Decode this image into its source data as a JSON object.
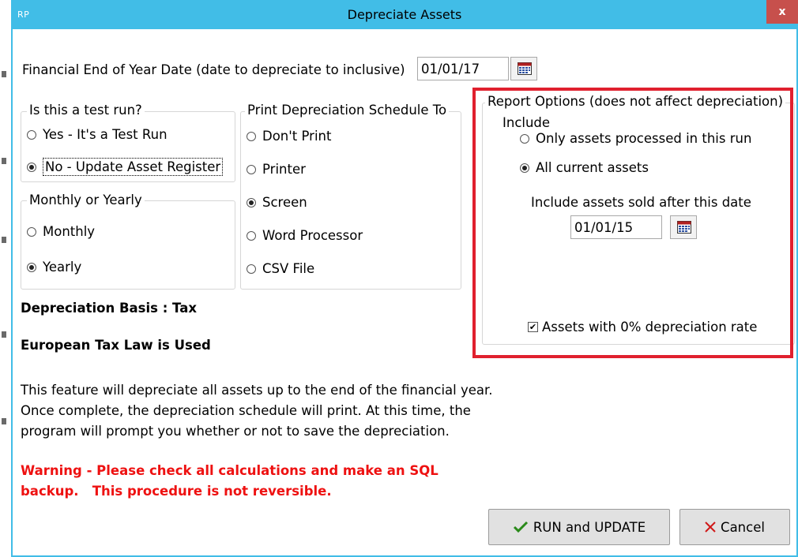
{
  "window": {
    "icon_text": "RP",
    "title": "Depreciate Assets",
    "close_label": "x"
  },
  "fy": {
    "label": "Financial End of Year Date (date to depreciate to inclusive)",
    "value": "01/01/17",
    "calendar_icon": "calendar-icon"
  },
  "test_run": {
    "legend": "Is this a test run?",
    "options": [
      {
        "label": "Yes - It's a Test Run",
        "selected": false
      },
      {
        "label": "No - Update Asset Register",
        "selected": true
      }
    ]
  },
  "period": {
    "legend": "Monthly or Yearly",
    "options": [
      {
        "label": "Monthly",
        "selected": false
      },
      {
        "label": "Yearly",
        "selected": true
      }
    ]
  },
  "print_to": {
    "legend": "Print Depreciation Schedule To",
    "options": [
      {
        "label": "Don't Print",
        "selected": false
      },
      {
        "label": "Printer",
        "selected": false
      },
      {
        "label": "Screen",
        "selected": true
      },
      {
        "label": "Word Processor",
        "selected": false
      },
      {
        "label": "CSV File",
        "selected": false
      }
    ]
  },
  "report": {
    "legend": "Report Options (does not affect depreciation)",
    "include_label": "Include",
    "options": [
      {
        "label": "Only assets processed in this run",
        "selected": false
      },
      {
        "label": "All current assets",
        "selected": true
      }
    ],
    "sold_after_label": "Include assets sold after this date",
    "sold_after_value": "01/01/15",
    "zero_rate_label": "Assets with 0% depreciation rate",
    "zero_rate_checked": true,
    "highlight_color": "#e0202e"
  },
  "info": {
    "basis": "Depreciation Basis : Tax",
    "law": "European Tax Law is Used",
    "paragraph": "This feature will depreciate all assets up to the end of the financial year. Once complete, the depreciation schedule will print. At this time, the program will prompt you whether or not to save the depreciation.",
    "warning": "Warning - Please check all calculations and make an SQL\nbackup.   This procedure is not reversible.",
    "warning_color": "#ee1111"
  },
  "buttons": {
    "run_label": "RUN and UPDATE",
    "run_icon": "checkmark-icon",
    "cancel_label": "Cancel",
    "cancel_icon": "x-icon"
  }
}
